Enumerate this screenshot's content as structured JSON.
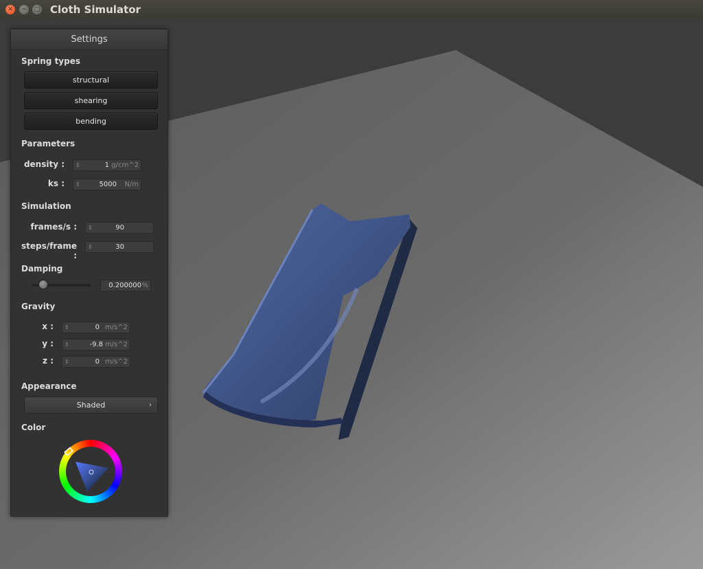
{
  "window": {
    "title": "Cloth Simulator"
  },
  "panel": {
    "title": "Settings",
    "spring_types": {
      "heading": "Spring types",
      "buttons": [
        "structural",
        "shearing",
        "bending"
      ]
    },
    "parameters": {
      "heading": "Parameters",
      "density": {
        "label": "density :",
        "value": "1",
        "unit": "g/cm^2"
      },
      "ks": {
        "label": "ks :",
        "value": "5000",
        "unit": "N/m"
      }
    },
    "simulation": {
      "heading": "Simulation",
      "fps": {
        "label": "frames/s :",
        "value": "90"
      },
      "steps": {
        "label": "steps/frame :",
        "value": "30"
      }
    },
    "damping": {
      "heading": "Damping",
      "value": "0.200000",
      "unit": "%",
      "level": 0.2
    },
    "gravity": {
      "heading": "Gravity",
      "x": {
        "label": "x :",
        "value": "0",
        "unit": "m/s^2"
      },
      "y": {
        "label": "y :",
        "value": "-9.8",
        "unit": "m/s^2"
      },
      "z": {
        "label": "z :",
        "value": "0",
        "unit": "m/s^2"
      }
    },
    "appearance": {
      "heading": "Appearance",
      "selected": "Shaded"
    },
    "color": {
      "heading": "Color",
      "selected_color": "#3b4e7a"
    }
  }
}
